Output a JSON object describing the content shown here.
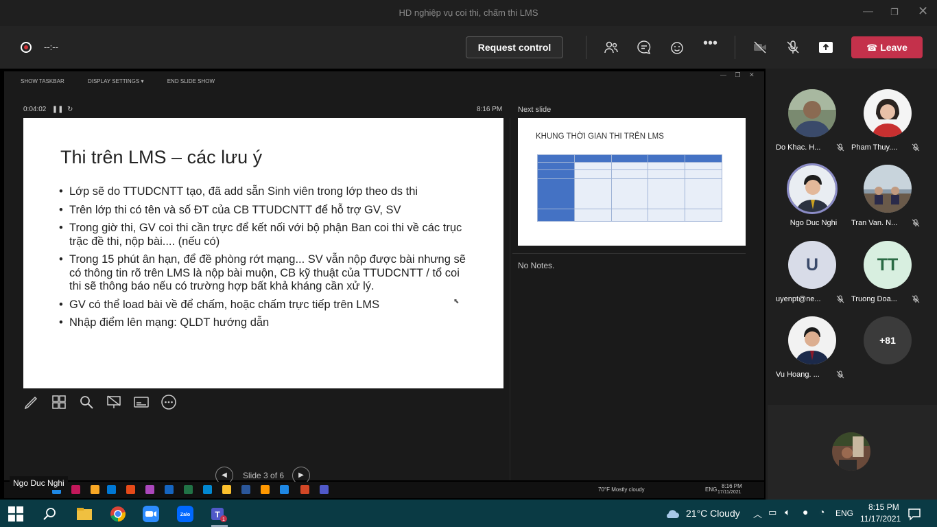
{
  "window": {
    "title": "HD nghiệp vụ coi thi, chấm thi LMS"
  },
  "toolbar": {
    "timer": "--:--",
    "request_control": "Request control",
    "leave": "Leave"
  },
  "presenter": {
    "top_menu": [
      "SHOW TASKBAR",
      "DISPLAY SETTINGS ▾",
      "END SLIDE SHOW"
    ],
    "elapsed": "0:04:02",
    "clock": "8:16 PM",
    "next_slide_label": "Next slide",
    "notes": "No Notes.",
    "slide_counter": "Slide 3 of 6",
    "presenter_name": "Ngo Duc Nghi"
  },
  "slide": {
    "title": "Thi trên LMS – các lưu ý",
    "bullets": [
      "Lớp sẽ do TTUDCNTT tạo, đã add sẵn Sinh viên trong lớp theo ds thi",
      "Trên lớp thi có tên và số ĐT của CB TTUDCNTT để hỗ trợ GV, SV",
      "Trong giờ thi, GV coi thi cần trực để kết nối với bộ phận Ban coi thi về các trục trặc đề thi, nộp bài.... (nếu có)",
      "Trong 15 phút ân hạn, để đề phòng rớt mạng... SV vẫn nộp được bài nhưng sẽ có thông tin rõ trên LMS là nộp bài muộn, CB kỹ thuật của TTUDCNTT / tổ coi thi sẽ thông báo nếu có trường hợp bất khả kháng cần xử lý.",
      "GV có thể load bài về để chấm, hoặc chấm trực tiếp trên LMS",
      "Nhập điểm lên mạng: QLDT hướng dẫn"
    ]
  },
  "next_slide": {
    "title": "KHUNG THỜI GIAN THI TRÊN LMS"
  },
  "inner_taskbar": {
    "weather": "70°F  Mostly cloudy",
    "lang": "ENG",
    "time": "8:16 PM",
    "date": "17/11/2021"
  },
  "participants": [
    {
      "name": "Do Khac. H...",
      "type": "photo",
      "muted": true
    },
    {
      "name": "Pham Thuy....",
      "type": "photo",
      "muted": true
    },
    {
      "name": "Ngo Duc Nghi",
      "type": "photo",
      "muted": false,
      "speaking": true
    },
    {
      "name": "Tran Van. N...",
      "type": "photo",
      "muted": true
    },
    {
      "name": "uyenpt@ne...",
      "type": "initials",
      "initials": "U",
      "color": "#d8dce8",
      "muted": true
    },
    {
      "name": "Truong Doa...",
      "type": "initials",
      "initials": "TT",
      "color": "#d8efe0",
      "muted": true
    },
    {
      "name": "Vu Hoang. ...",
      "type": "photo",
      "muted": true
    },
    {
      "name": "",
      "type": "more",
      "initials": "+81",
      "muted": false
    }
  ],
  "taskbar": {
    "weather": "21°C  Cloudy",
    "lang": "ENG",
    "time": "8:15 PM",
    "date": "11/17/2021",
    "teams_badge": "1"
  },
  "colors": {
    "leave": "#c4314b",
    "taskbar": "#0a3a44",
    "speaking_ring": "#8b8cc7"
  }
}
